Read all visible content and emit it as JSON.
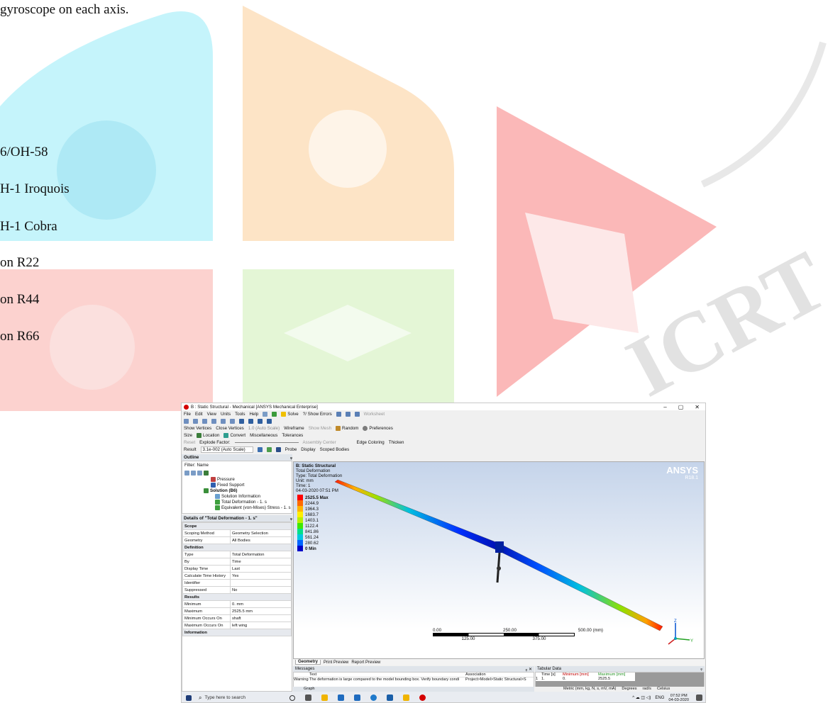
{
  "document": {
    "lines": [
      "gyroscope on each axis.",
      "6/OH-58",
      "H-1 Iroquois",
      "H-1 Cobra",
      "on R22",
      "on R44",
      "on R66"
    ],
    "watermark": "IJCRT"
  },
  "window": {
    "title": "B : Static Structural - Mechanical [ANSYS Mechanical Enterprise]",
    "controls": [
      "–",
      "▢",
      "✕"
    ]
  },
  "menu": [
    "File",
    "Edit",
    "View",
    "Units",
    "Tools",
    "Help"
  ],
  "toolbar1": {
    "solve": "Solve",
    "show_errors": "?/ Show Errors",
    "worksheet": "Worksheet"
  },
  "toolbar2": {
    "show_vertices": "Show Vertices",
    "close_vertices": "Close Vertices",
    "auto_scale": "1.0 (Auto Scale)",
    "wireframe": "Wireframe",
    "show_mesh": "Show Mesh",
    "random": "Random",
    "preferences": "Preferences"
  },
  "toolbar3": {
    "size": "Size",
    "location": "Location",
    "convert": "Convert",
    "miscellaneous": "Miscellaneous",
    "tolerances": "Tolerances"
  },
  "toolbar4": {
    "reset": "Reset",
    "explode_factor": "Explode Factor:",
    "assembly_center": "Assembly Center",
    "edge_coloring": "Edge Coloring",
    "thicken": "Thicken"
  },
  "toolbar5": {
    "result_label": "Result",
    "result_value": "3.1e-002 (Auto Scale)",
    "probe": "Probe",
    "display_label": "Display",
    "display_value": "Scoped Bodies"
  },
  "outline": {
    "header": "Outline",
    "filter_label": "Filter:",
    "filter_value": "Name",
    "items": [
      "Pressure",
      "Fixed Support",
      "Solution (B6)",
      "Solution Information",
      "Total Deformation - 1. s",
      "Equivalent (von-Mises) Stress - 1. s"
    ]
  },
  "details": {
    "header": "Details of \"Total Deformation - 1. s\"",
    "groups": [
      {
        "name": "Scope",
        "rows": [
          [
            "Scoping Method",
            "Geometry Selection"
          ],
          [
            "Geometry",
            "All Bodies"
          ]
        ]
      },
      {
        "name": "Definition",
        "rows": [
          [
            "Type",
            "Total Deformation"
          ],
          [
            "By",
            "Time"
          ],
          [
            "Display Time",
            "Last"
          ],
          [
            "Calculate Time History",
            "Yes"
          ],
          [
            "Identifier",
            ""
          ],
          [
            "Suppressed",
            "No"
          ]
        ]
      },
      {
        "name": "Results",
        "rows": [
          [
            "Minimum",
            "0. mm"
          ],
          [
            "Maximum",
            "2525.5 mm"
          ],
          [
            "Minimum Occurs On",
            "shaft"
          ],
          [
            "Maximum Occurs On",
            "left wing"
          ]
        ]
      },
      {
        "name": "Information",
        "rows": []
      }
    ]
  },
  "graphics": {
    "title": "B: Static Structural",
    "info": [
      "Total Deformation",
      "Type: Total Deformation",
      "Unit: mm",
      "Time: 1",
      "04-03-2020 07:51 PM"
    ],
    "brand": "ANSYS",
    "version": "R18.1",
    "legend": {
      "values": [
        "2525.5 Max",
        "2244.9",
        "1964.3",
        "1683.7",
        "1403.1",
        "1122.4",
        "841.86",
        "561.24",
        "280.62",
        "0 Min"
      ],
      "colors": [
        "#ff0000",
        "#ff6a00",
        "#ffb400",
        "#ffee00",
        "#b6f000",
        "#3ee800",
        "#00e08a",
        "#00c8e0",
        "#0064ff",
        "#0000c8"
      ]
    },
    "scale": {
      "top": [
        "0.00",
        "250.00",
        "500.00 (mm)"
      ],
      "bottom": [
        "125.00",
        "375.00"
      ]
    },
    "axes": [
      "Z",
      "Y"
    ]
  },
  "tabs": [
    "Geometry",
    "Print Preview",
    "Report Preview"
  ],
  "messages": {
    "header": "Messages",
    "columns": [
      "Text",
      "Association"
    ],
    "row": [
      "Warning",
      "The deformation is large compared to the model bounding box. Verify boundary condi",
      "Project>Model>Static Structural>S"
    ]
  },
  "tabular": {
    "header": "Tabular Data",
    "columns": [
      "Time [s]",
      "Minimum [mm]",
      "Maximum [mm]"
    ],
    "row": [
      "1",
      "1.",
      "0.",
      "2525.5"
    ]
  },
  "graph_header": "Graph",
  "status": {
    "units": "Metric (mm, kg, N, s, mV, mA)",
    "degrees": "Degrees",
    "rads": "rad/s",
    "temp": "Celsius"
  },
  "taskbar": {
    "search_placeholder": "Type here to search",
    "time": "07:52 PM",
    "date": "04-03-2020",
    "lang": "ENG"
  }
}
